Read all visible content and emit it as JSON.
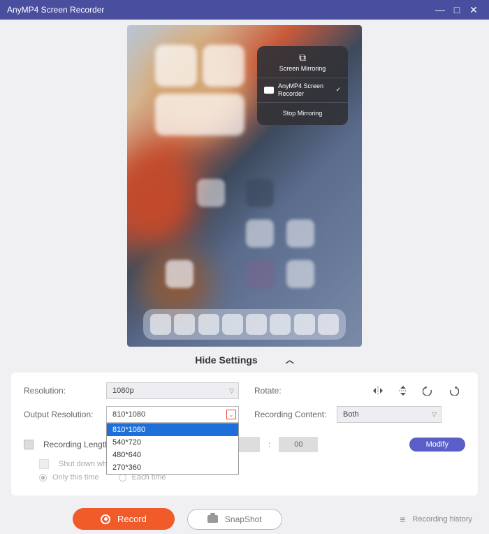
{
  "titlebar": {
    "title": "AnyMP4 Screen Recorder"
  },
  "preview": {
    "popup": {
      "title": "Screen Mirroring",
      "item": "AnyMP4 Screen Recorder",
      "stop": "Stop Mirroring"
    }
  },
  "hideSettings": {
    "label": "Hide Settings"
  },
  "settings": {
    "resolution": {
      "label": "Resolution:",
      "value": "1080p"
    },
    "outputResolution": {
      "label": "Output Resolution:",
      "value": "810*1080",
      "options": [
        "810*1080",
        "540*720",
        "480*640",
        "270*360"
      ]
    },
    "rotate": {
      "label": "Rotate:"
    },
    "recordingContent": {
      "label": "Recording Content:",
      "value": "Both"
    },
    "recordingLength": {
      "label": "Recording Length",
      "hh": "",
      "mm": "",
      "ss": "00",
      "modify": "Modify"
    },
    "shutdown": {
      "label": "Shut down when recording ends"
    },
    "onlyThisTime": "Only this time",
    "eachTime": "Each time"
  },
  "bottom": {
    "record": "Record",
    "snapshot": "SnapShot",
    "history": "Recording history"
  }
}
